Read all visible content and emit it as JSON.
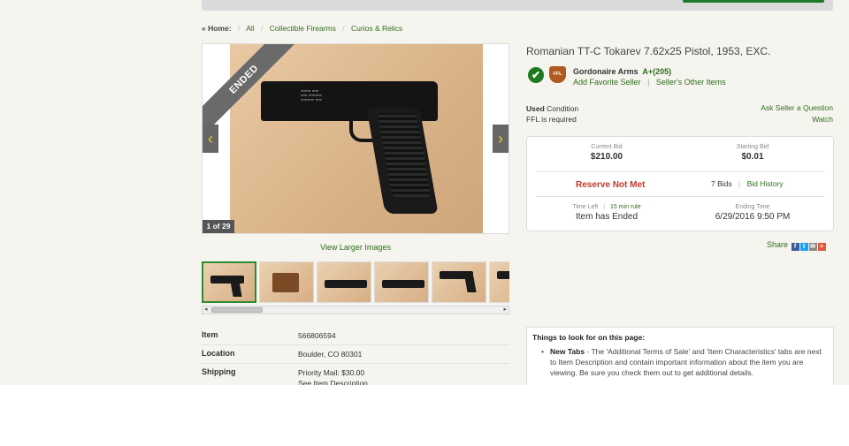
{
  "breadcrumb": {
    "home": "« Home:",
    "items": [
      "All",
      "Collectible Firearms",
      "Curios & Relics"
    ]
  },
  "gallery": {
    "ribbon": "ENDED",
    "counter": "1 of 29",
    "prev_icon": "‹",
    "next_icon": "›",
    "view_larger": "View Larger Images",
    "thumb_count": 6
  },
  "details": [
    {
      "label": "Item",
      "value": "566806594"
    },
    {
      "label": "Location",
      "value": "Boulder, CO 80301"
    },
    {
      "label": "Shipping",
      "value": "Priority Mail: $30.00",
      "value2": "See Item Description"
    }
  ],
  "listing": {
    "title": "Romanian TT-C Tokarev 7.62x25 Pistol, 1953, EXC."
  },
  "seller": {
    "check_icon": "✔",
    "ffl_label": "FFL",
    "name": "Gordonaire Arms",
    "rating": "A+(205)",
    "add_favorite": "Add Favorite Seller",
    "other_items": "Seller's Other Items"
  },
  "condition": {
    "label_bold": "Used",
    "label": "Condition",
    "ffl": "FFL is required"
  },
  "actions": {
    "ask_question": "Ask Seller a Question",
    "watch": "Watch"
  },
  "bid": {
    "current_label": "Current Bid",
    "current_value": "$210.00",
    "starting_label": "Starting Bid",
    "starting_value": "$0.01",
    "reserve": "Reserve Not Met",
    "bids_count": "7 Bids",
    "bid_history": "Bid History",
    "time_left_label": "Time Left",
    "rule_link": "15 min rule",
    "time_left_value": "Item has Ended",
    "ending_label": "Ending Time",
    "ending_value": "6/29/2016 9:50 PM"
  },
  "share": {
    "label": "Share",
    "icons": [
      {
        "name": "facebook",
        "glyph": "f",
        "color": "#3b5998"
      },
      {
        "name": "twitter",
        "glyph": "t",
        "color": "#1da1f2"
      },
      {
        "name": "email",
        "glyph": "✉",
        "color": "#888888"
      },
      {
        "name": "more",
        "glyph": "+",
        "color": "#e05a3a"
      }
    ]
  },
  "things": {
    "title": "Things to look for on this page:",
    "item1_bold": "New Tabs",
    "item1_text": " - The 'Additional Terms of Sale' and 'Item Characteristics' tabs are next to Item Description and contain important information about the item you are viewing. Be sure you check them out to get additional details."
  },
  "colors": {
    "link_green": "#2e6d1f",
    "reserve_red": "#c0392b",
    "page_bg": "#f6f4ee"
  }
}
